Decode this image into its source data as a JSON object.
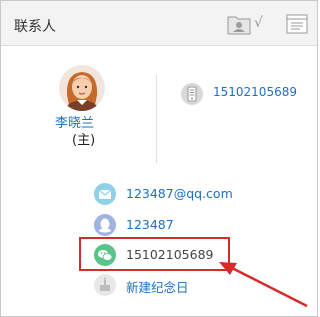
{
  "header": {
    "title": "联系人",
    "check_mark": "√"
  },
  "icons": {
    "card": "contact-card-icon",
    "list": "list-view-icon",
    "mobile": "mobile-phone-icon",
    "email": "email-icon",
    "qq": "qq-icon",
    "wechat": "wechat-icon",
    "memorial": "memorial-day-icon"
  },
  "contact": {
    "name": "李晓兰",
    "role": "(主)",
    "phone": "15102105689"
  },
  "details": {
    "email": "123487@qq.com",
    "qq": "123487",
    "wechat": "15102105689",
    "memorial_link": "新建纪念日"
  },
  "colors": {
    "link": "#1e6fc4",
    "highlight": "#d92a2a",
    "wechat": "#59c38a"
  }
}
